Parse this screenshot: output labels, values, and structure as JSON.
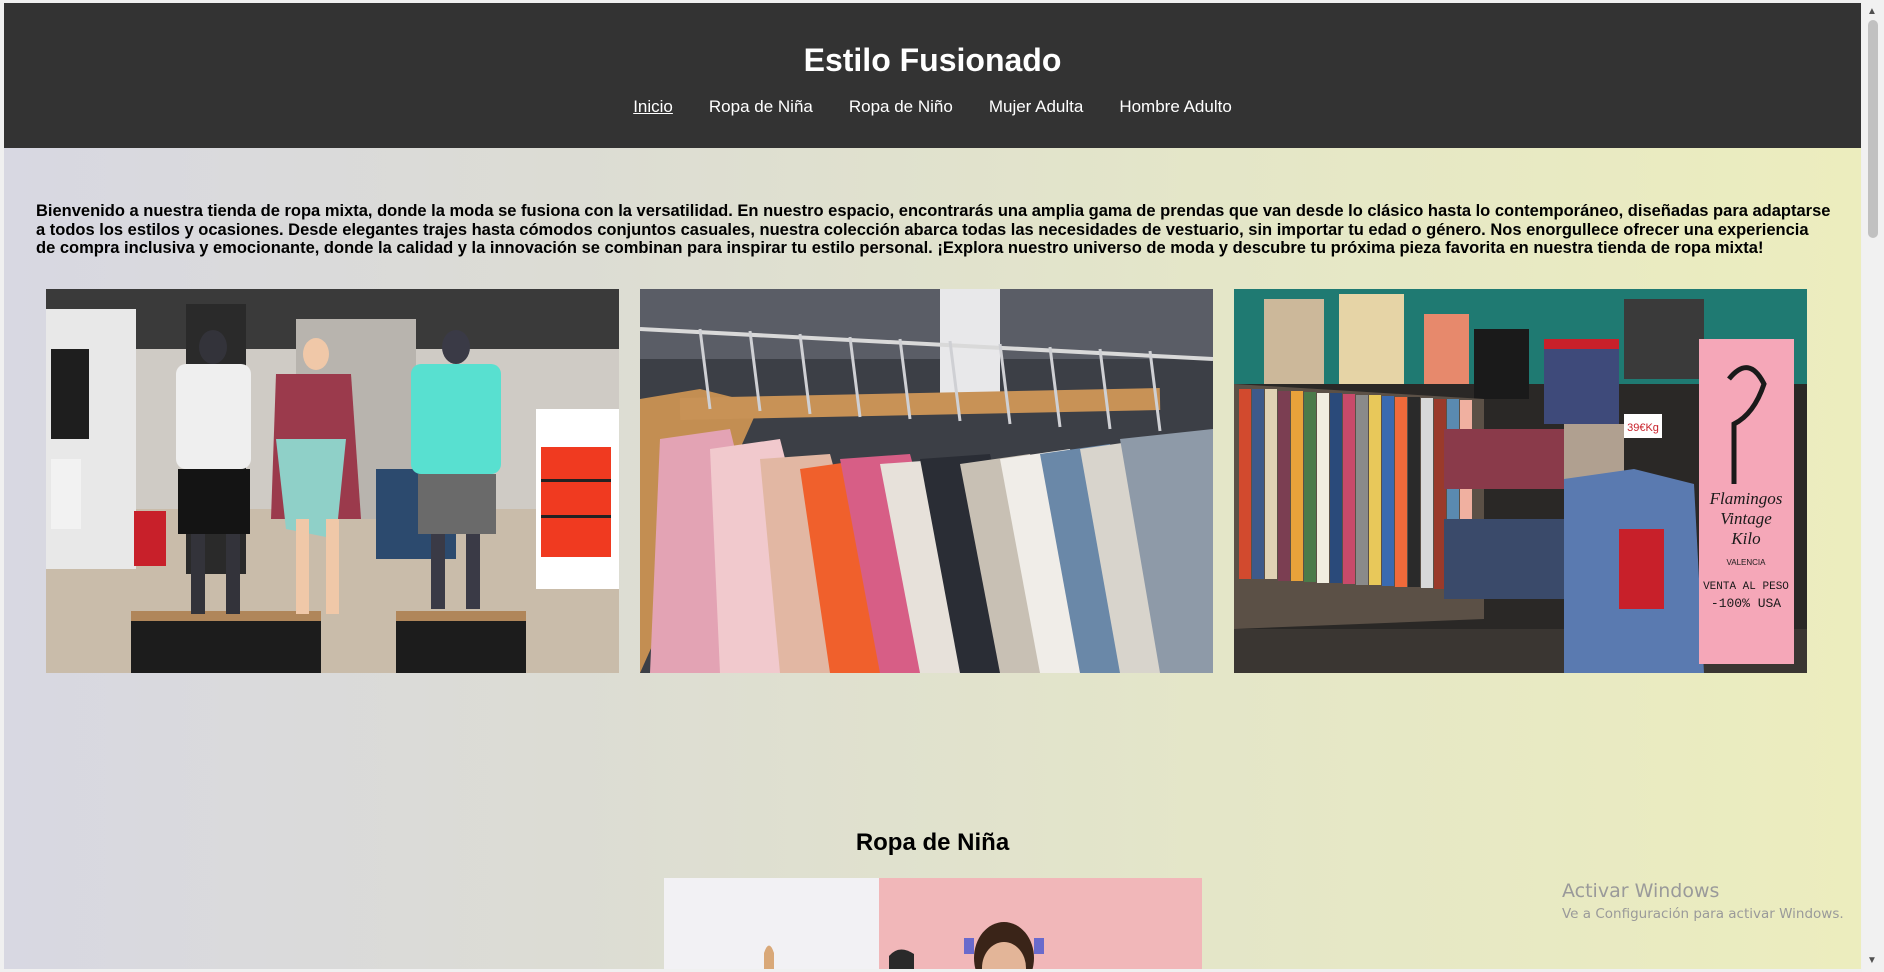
{
  "header": {
    "title": "Estilo Fusionado",
    "nav": [
      {
        "label": "Inicio",
        "active": true
      },
      {
        "label": "Ropa de Niña",
        "active": false
      },
      {
        "label": "Ropa de Niño",
        "active": false
      },
      {
        "label": "Mujer Adulta",
        "active": false
      },
      {
        "label": "Hombre Adulto",
        "active": false
      }
    ]
  },
  "intro": {
    "text": "Bienvenido a nuestra tienda de ropa mixta, donde la moda se fusiona con la versatilidad. En nuestro espacio, encontrarás una amplia gama de prendas que van desde lo clásico hasta lo contemporáneo, diseñadas para adaptarse a todos los estilos y ocasiones. Desde elegantes trajes hasta cómodos conjuntos casuales, nuestra colección abarca todas las necesidades de vestuario, sin importar tu edad o género. Nos enorgullece ofrecer una experiencia de compra inclusiva y emocionante, donde la calidad y la innovación se combinan para inspirar tu estilo personal. ¡Explora nuestro universo de moda y descubre tu próxima pieza favorita en nuestra tienda de ropa mixta!"
  },
  "sections": {
    "girls_title": "Ropa de Niña"
  },
  "photos": {
    "store_sign_line1": "Flamingos",
    "store_sign_line2": "Vintage",
    "store_sign_line3": "Kilo",
    "store_sign_city": "VALENCIA",
    "store_sign_offer1": "VENTA AL PESO",
    "store_sign_offer2": "-100% USA",
    "price_tag": "39€Kg"
  },
  "watermark": {
    "title": "Activar Windows",
    "subtitle": "Ve a Configuración para activar Windows."
  },
  "colors": {
    "header_bg": "#333333",
    "header_text": "#ffffff"
  }
}
